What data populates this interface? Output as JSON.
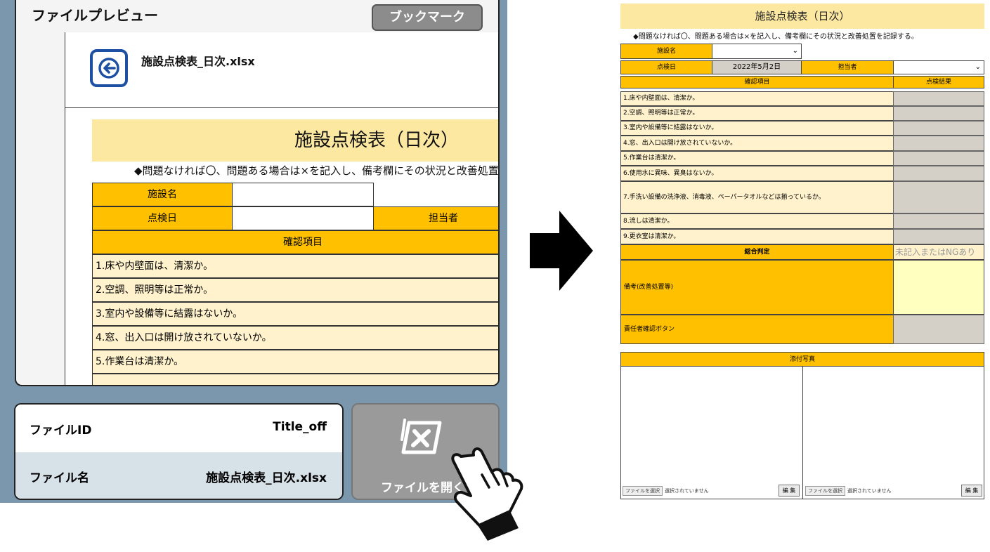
{
  "preview": {
    "title": "ファイルプレビュー",
    "bookmark_label": "ブックマーク",
    "file_name": "施設点検表_日次.xlsx"
  },
  "preview_sheet": {
    "title": "施設点検表（日次）",
    "note": "◆問題なければ〇、問題ある場合は×を記入し、備考欄にその状況と改善処置",
    "facility_label": "施設名",
    "date_label": "点検日",
    "staff_label": "担当者",
    "check_header": "確認項目",
    "items": [
      "1.床や内壁面は、清潔か。",
      "2.空調、照明等は正常か。",
      "3.室内や設備等に結露はないか。",
      "4.窓、出入口は開け放されていないか。",
      "5.作業台は清潔か。"
    ]
  },
  "info": {
    "id_label": "ファイルID",
    "id_value": "Title_off",
    "name_label": "ファイル名",
    "name_value": "施設点検表_日次.xlsx"
  },
  "open_button": {
    "label": "ファイルを開く"
  },
  "sheet": {
    "title": "施設点検表（日次）",
    "note": "◆問題なければ〇、問題ある場合は×を記入し、備考欄にその状況と改善処置を記録する。",
    "facility_label": "施設名",
    "date_label": "点検日",
    "date_value": "2022年5月2日",
    "staff_label": "担当者",
    "check_header": "確認項目",
    "result_header": "点検結果",
    "items": [
      "1.床や内壁面は、清潔か。",
      "2.空調、照明等は正常か。",
      "3.室内や設備等に結露はないか。",
      "4.窓、出入口は開け放されていないか。",
      "5.作業台は清潔か。",
      "6.使用水に異味、異臭はないか。",
      "7.手洗い設備の洗浄液、消毒液、ペーパータオルなどは揃っているか。",
      "8.流しは清潔か。",
      "9.更衣室は清潔か。"
    ],
    "overall_label": "総合判定",
    "overall_value": "未記入またはNGあり",
    "remarks_label": "備考(改善処置等)",
    "manager_label": "責任者確認ボタン",
    "photo_header": "添付写真",
    "file_pick_label": "ファイルを選択",
    "file_none_label": "選択されていません",
    "edit_label": "編 集"
  },
  "colors": {
    "app_background": "#7a97ad",
    "header_orange": "#ffc000",
    "cream": "#fff2cc",
    "title_yellow": "#fde8a2",
    "back_icon_blue": "#1d4fa3"
  }
}
